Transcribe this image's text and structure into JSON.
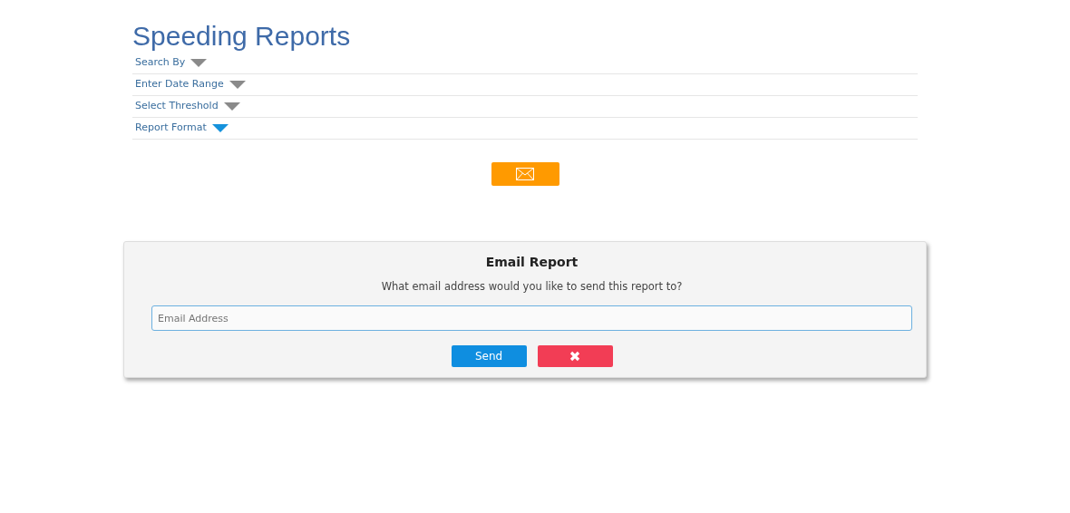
{
  "title": "Speeding Reports",
  "sections": [
    {
      "label": "Search By",
      "selected": false
    },
    {
      "label": "Enter Date Range",
      "selected": false
    },
    {
      "label": "Select Threshold",
      "selected": false
    },
    {
      "label": "Report Format",
      "selected": true
    }
  ],
  "dialog": {
    "title": "Email Report",
    "message": "What email address would you like to send this report to?",
    "email": {
      "placeholder": "Email Address"
    },
    "send_button": "Send"
  }
}
